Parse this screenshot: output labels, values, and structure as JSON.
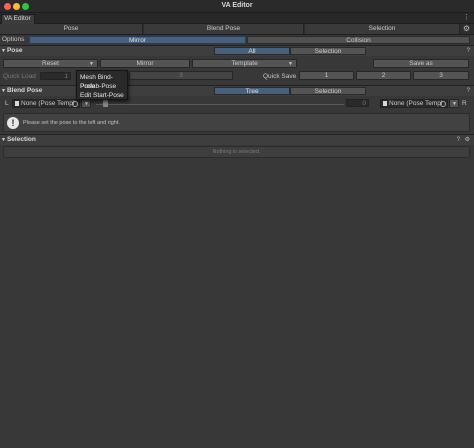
{
  "window": {
    "title": "VA Editor"
  },
  "tab": {
    "label": "VA Editor"
  },
  "toolbar": {
    "items": [
      "Pose",
      "Blend Pose",
      "Selection"
    ]
  },
  "options": {
    "label": "Options",
    "mirror": "Mirror",
    "collision": "Collision"
  },
  "pose": {
    "title": "Pose",
    "seg_all": "All",
    "seg_selection": "Selection",
    "reset": "Reset",
    "mirror": "Mirror",
    "template": "Template",
    "save_as": "Save as",
    "quick_load_label": "Quick Load",
    "quick_load_value": "1",
    "quick_load_3": "3",
    "quick_save_label": "Quick Save",
    "quick_save_buttons": [
      "1",
      "2",
      "3"
    ]
  },
  "popup": {
    "items": [
      "Mesh Bind-Pose",
      "Prefab-Pose",
      "Edit Start-Pose"
    ]
  },
  "blend": {
    "title": "Blend Pose",
    "seg_tree": "Tree",
    "seg_selection": "Selection",
    "left_label": "L",
    "left_field": "None (Pose Templ",
    "right_field": "None (Pose Templ",
    "right_label": "R",
    "slider_value": "0"
  },
  "helpbox": {
    "icon": "!",
    "text": "Please set the pose to the left and right."
  },
  "selection": {
    "title": "Selection",
    "empty_text": "Nothing is selected."
  },
  "colors": {
    "accent": "#46607e",
    "background": "#383838"
  }
}
